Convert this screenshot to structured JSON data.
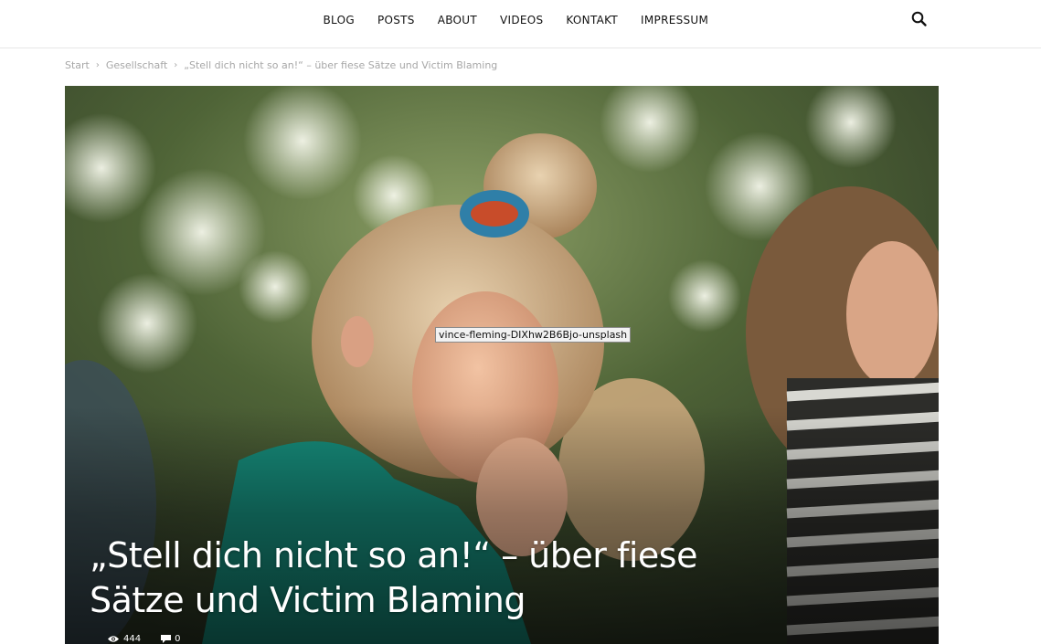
{
  "nav": {
    "items": [
      {
        "label": "BLOG"
      },
      {
        "label": "POSTS"
      },
      {
        "label": "ABOUT"
      },
      {
        "label": "VIDEOS"
      },
      {
        "label": "KONTAKT"
      },
      {
        "label": "IMPRESSUM"
      }
    ],
    "search_icon": "search-icon"
  },
  "breadcrumb": {
    "items": [
      {
        "label": "Start"
      },
      {
        "label": "Gesellschaft"
      },
      {
        "label": "„Stell dich nicht so an!“ – über fiese Sätze und Victim Blaming"
      }
    ],
    "separator": "›"
  },
  "hero": {
    "image_tooltip": "vince-fleming-DIXhw2B6Bjo-unsplash",
    "title_line1": "„Stell dich nicht so an!“ – über fiese",
    "title_line2": "Sätze und Victim Blaming",
    "views": "444",
    "comments": "0",
    "views_icon": "eye-icon",
    "comments_icon": "comment-icon"
  }
}
